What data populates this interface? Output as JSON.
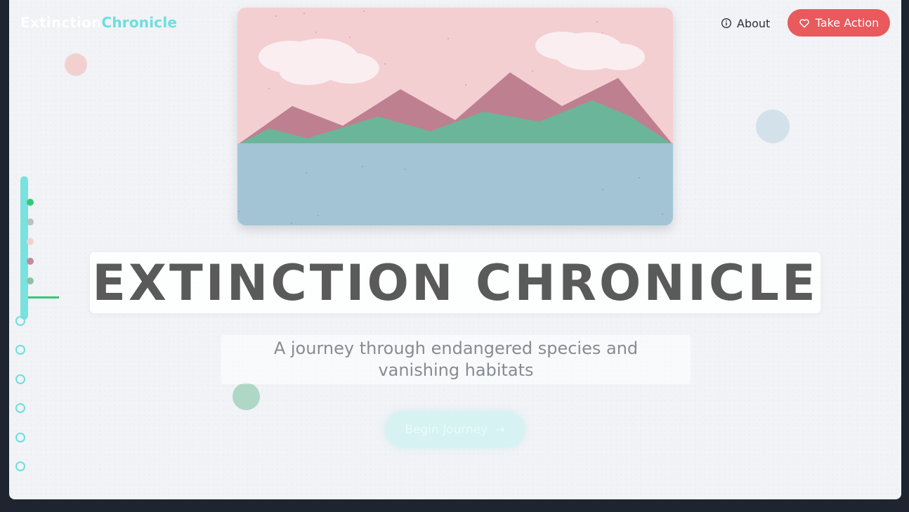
{
  "logo": {
    "part1": "Extinction",
    "part2": "Chronicle"
  },
  "nav": {
    "about_label": "About",
    "about_icon": "info-icon",
    "take_action_label": "Take Action",
    "take_action_icon": "heart-icon"
  },
  "hero": {
    "title": "EXTINCTION CHRONICLE",
    "subtitle": "A journey through endangered species and vanishing habitats",
    "cta_label": "Begin Journey",
    "cta_icon": "arrow-right-icon"
  },
  "timeline": {
    "dot_colors": [
      "#34c97a",
      "#b6c3bd",
      "#f3d0d0",
      "#c48a99",
      "#8fbfa6"
    ],
    "nav_points": 6
  },
  "colors": {
    "accent": "#6fdede",
    "action": "#e85a5c",
    "background": "#f1f3f6",
    "sky": "#f3cfd2",
    "mountains": "#be8090",
    "hills": "#6bb59a",
    "water": "#a3c4d5"
  }
}
